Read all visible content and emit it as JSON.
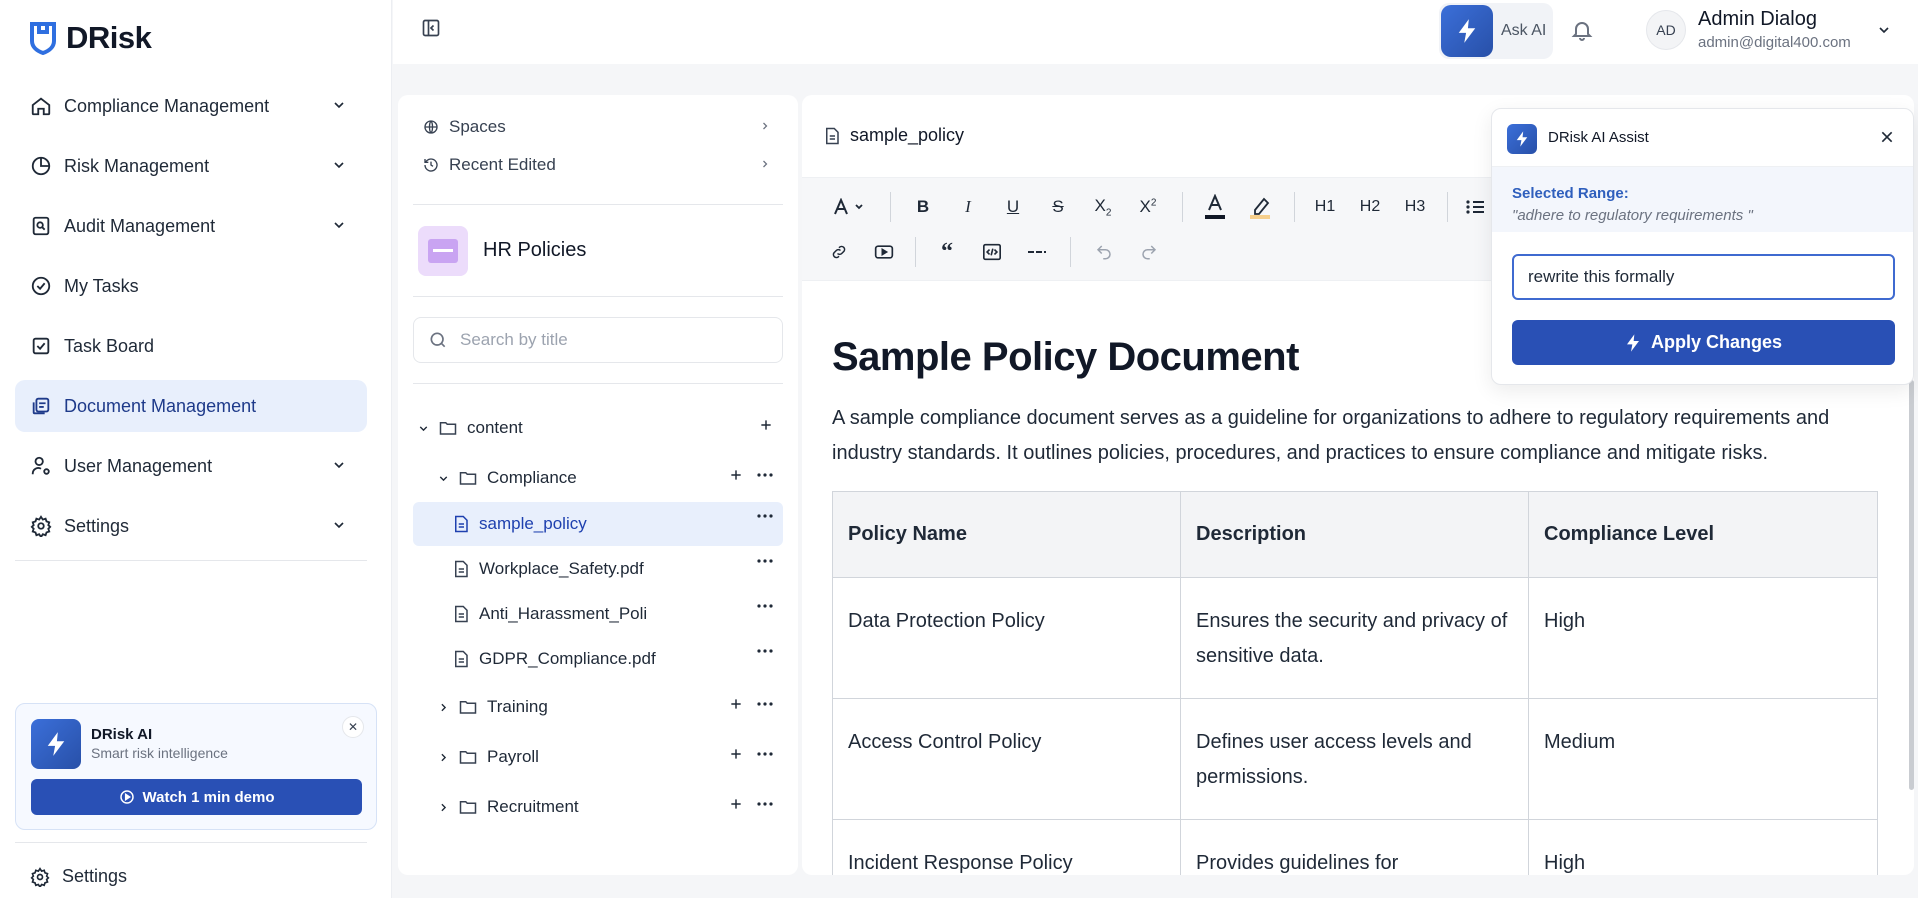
{
  "brand": {
    "name": "DRisk"
  },
  "sidebar": {
    "items": [
      {
        "label": "Compliance Management",
        "icon": "home-icon",
        "expandable": true
      },
      {
        "label": "Risk Management",
        "icon": "pie-chart-icon",
        "expandable": true
      },
      {
        "label": "Audit Management",
        "icon": "audit-search-icon",
        "expandable": true
      },
      {
        "label": "My Tasks",
        "icon": "check-circle-icon",
        "expandable": false
      },
      {
        "label": "Task Board",
        "icon": "check-square-icon",
        "expandable": false
      },
      {
        "label": "Document Management",
        "icon": "documents-icon",
        "expandable": false,
        "active": true
      },
      {
        "label": "User Management",
        "icon": "user-gear-icon",
        "expandable": true
      },
      {
        "label": "Settings",
        "icon": "gear-icon",
        "expandable": true
      }
    ],
    "ai_card": {
      "title": "DRisk AI",
      "subtitle": "Smart risk intelligence",
      "button": "Watch 1 min demo"
    },
    "bottom_settings": "Settings"
  },
  "topbar": {
    "ask_ai": "Ask AI",
    "user": {
      "initials": "AD",
      "name": "Admin Dialog",
      "email": "admin@digital400.com"
    }
  },
  "tree": {
    "links": [
      "Spaces",
      "Recent Edited"
    ],
    "space_title": "HR Policies",
    "search_placeholder": "Search by title",
    "nodes": [
      {
        "label": "content",
        "type": "folder",
        "expanded": true
      },
      {
        "label": "Compliance",
        "type": "folder",
        "expanded": true
      },
      {
        "label": "sample_policy",
        "type": "file",
        "selected": true
      },
      {
        "label": "Workplace_Safety.pdf",
        "type": "file"
      },
      {
        "label": "Anti_Harassment_Poli",
        "type": "file"
      },
      {
        "label": "GDPR_Compliance.pdf",
        "type": "file"
      },
      {
        "label": "Training",
        "type": "folder",
        "expanded": false
      },
      {
        "label": "Payroll",
        "type": "folder",
        "expanded": false
      },
      {
        "label": "Recruitment",
        "type": "folder",
        "expanded": false
      }
    ]
  },
  "editor": {
    "filename": "sample_policy",
    "toolbar": {
      "heading1": "H1",
      "heading2": "H2",
      "heading3": "H3"
    },
    "doc": {
      "title": "Sample Policy Document",
      "paragraph": "A sample compliance document serves as a guideline for organizations to adhere to regulatory requirements and industry standards. It outlines policies, procedures, and practices to ensure compliance and mitigate risks.",
      "table": {
        "headers": [
          "Policy Name",
          "Description",
          "Compliance Level"
        ],
        "rows": [
          [
            "Data Protection Policy",
            "Ensures the security and privacy of sensitive data.",
            "High"
          ],
          [
            "Access Control Policy",
            "Defines user access levels and permissions.",
            "Medium"
          ],
          [
            "Incident Response Policy",
            "Provides guidelines for",
            "High"
          ]
        ]
      }
    }
  },
  "assist": {
    "title": "DRisk AI Assist",
    "range_label": "Selected Range:",
    "range_text": "\"adhere to regulatory requirements \"",
    "input_value": "rewrite this formally",
    "apply_label": "Apply Changes"
  }
}
